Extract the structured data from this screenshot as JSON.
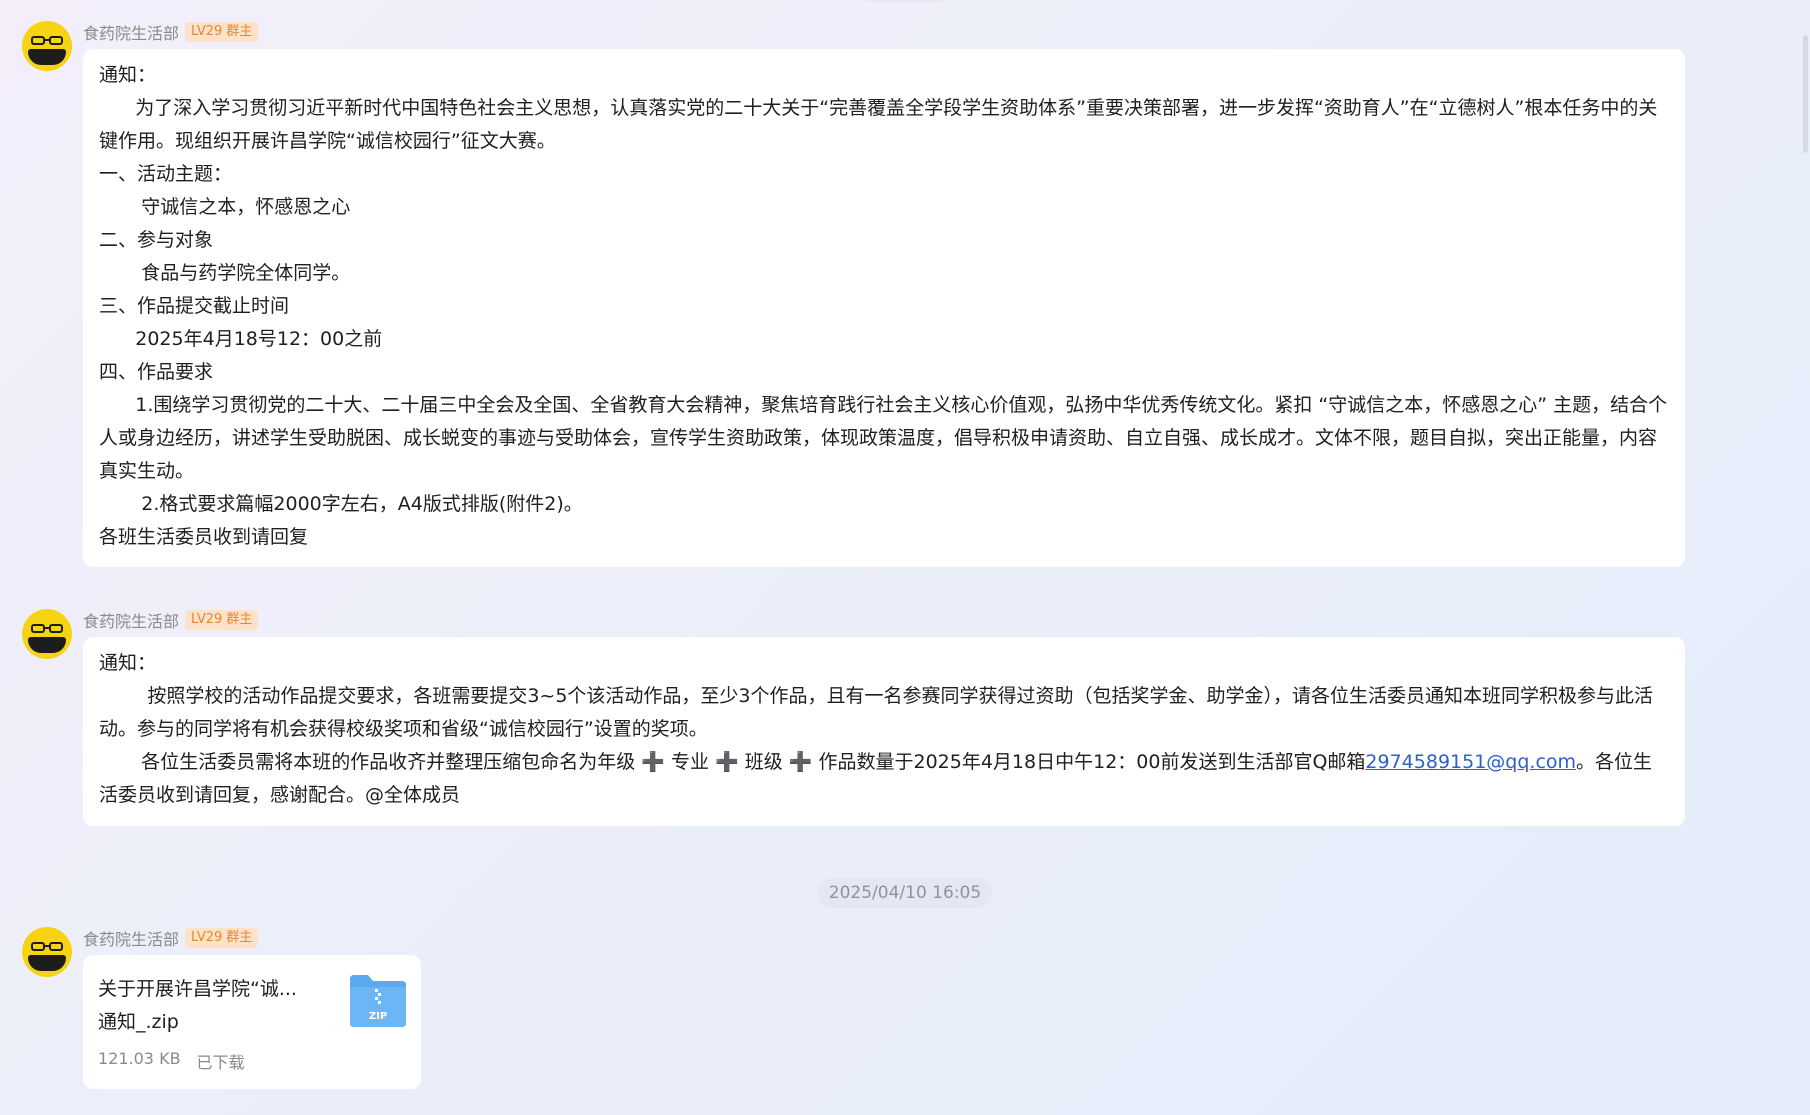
{
  "messages": [
    {
      "sender": "食药院生活部",
      "badge": "LV29 群主",
      "lines": [
        "通知：",
        "      为了深入学习贯彻习近平新时代中国特色社会主义思想，认真落实党的二十大关于“完善覆盖全学段学生资助体系”重要决策部署，进一步发挥“资助育人”在“立德树人”根本任务中的关键作用。现组织开展许昌学院“诚信校园行”征文大赛。",
        "一、活动主题：",
        "       守诚信之本，怀感恩之心",
        "二、参与对象",
        "       食品与药学院全体同学。",
        "三、作品提交截止时间",
        "      2025年4月18号12：00之前",
        "四、作品要求",
        "      1.围绕学习贯彻党的二十大、二十届三中全会及全国、全省教育大会精神，聚焦培育践行社会主义核心价值观，弘扬中华优秀传统文化。紧扣 “守诚信之本，怀感恩之心” 主题，结合个人或身边经历，讲述学生受助脱困、成长蜕变的事迹与受助体会，宣传学生资助政策，体现政策温度，倡导积极申请资助、自立自强、成长成才。文体不限，题目自拟，突出正能量，内容真实生动。",
        "       2.格式要求篇幅2000字左右，A4版式排版(附件2)。",
        "各班生活委员收到请回复"
      ]
    },
    {
      "sender": "食药院生活部",
      "badge": "LV29 群主",
      "line1": "通知：",
      "line2": "        按照学校的活动作品提交要求，各班需要提交3~5个该活动作品，至少3个作品，且有一名参赛同学获得过资助（包括奖学金、助学金），请各位生活委员通知本班同学积极参与此活动。参与的同学将有机会获得校级奖项和省级“诚信校园行”设置的奖项。",
      "line3_before": "       各位生活委员需将本班的作品收齐并整理压缩包命名为年级 ➕ 专业 ➕ 班级 ➕ 作品数量于2025年4月18日中午12：00前发送到生活部官Q邮箱",
      "email": "2974589151@qq.com",
      "line3_after": "。各位生活委员收到请回复，感谢配合。@全体成员"
    }
  ],
  "timestamp": "2025/04/10 16:05",
  "file_message": {
    "sender": "食药院生活部",
    "badge": "LV29 群主",
    "file_name_line1": "关于开展许昌学院“诚...",
    "file_name_line2": "通知_.zip",
    "file_size": "121.03 KB",
    "status": "已下载",
    "icon_label": "ZIP"
  },
  "colors": {
    "avatar": "#f6d313",
    "badge_text": "#e8872e",
    "badge_bg": "#fde2c9",
    "link": "#2a62c9",
    "zip_icon": "#5aa9f1"
  }
}
